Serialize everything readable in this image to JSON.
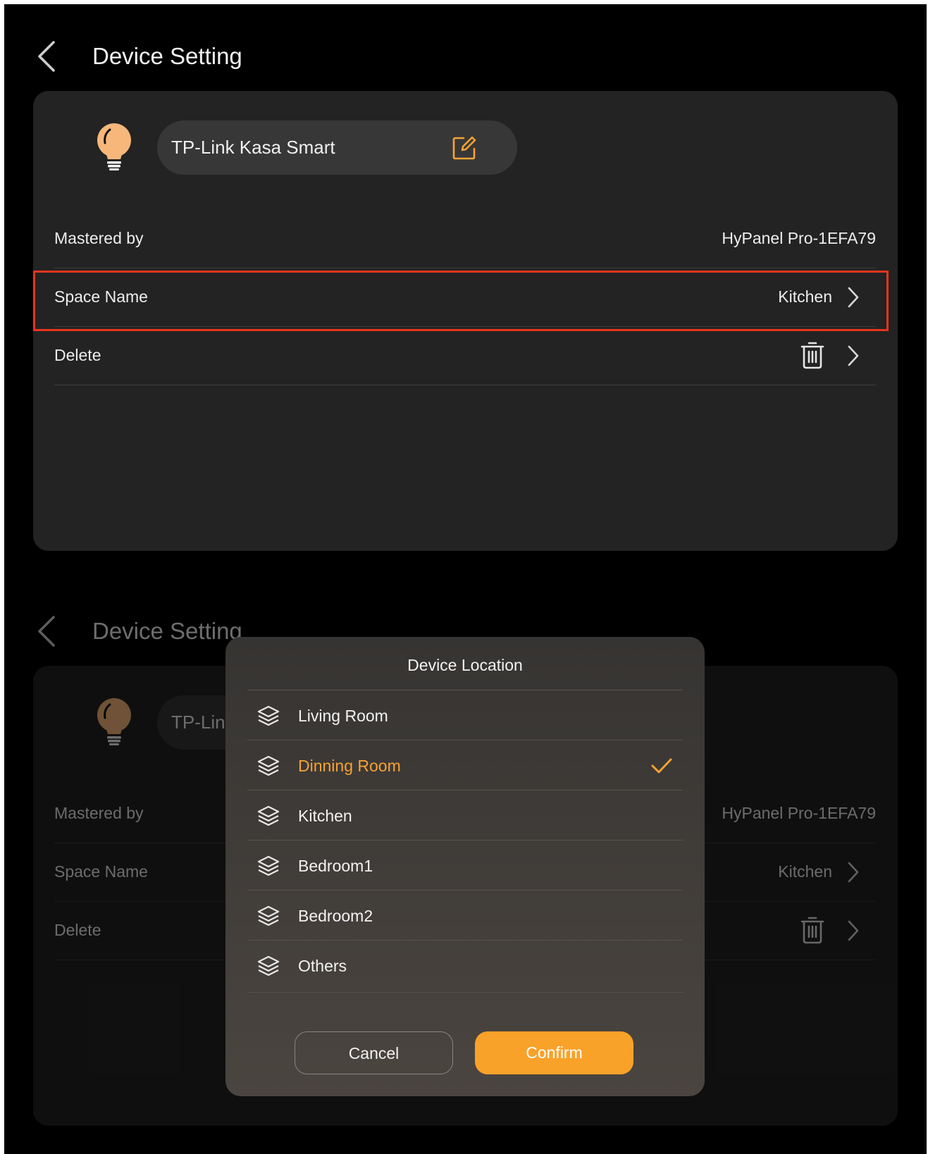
{
  "header": {
    "title": "Device Setting"
  },
  "device": {
    "name": "TP-Link Kasa Smart",
    "bulb_color": "#f7b77a"
  },
  "rows": {
    "mastered_by": {
      "label": "Mastered by",
      "value": "HyPanel Pro-1EFA79"
    },
    "space_name": {
      "label": "Space Name",
      "value": "Kitchen"
    },
    "delete": {
      "label": "Delete"
    }
  },
  "dialog": {
    "title": "Device Location",
    "options": [
      {
        "label": "Living Room",
        "icon": "layers-icon",
        "selected": false
      },
      {
        "label": "Dinning Room",
        "icon": "layers-icon",
        "selected": true
      },
      {
        "label": "Kitchen",
        "icon": "layers-icon",
        "selected": false
      },
      {
        "label": "Bedroom1",
        "icon": "layers-icon",
        "selected": false
      },
      {
        "label": "Bedroom2",
        "icon": "layers-icon",
        "selected": false
      },
      {
        "label": "Others",
        "icon": "layers-icon",
        "selected": false
      }
    ],
    "cancel_label": "Cancel",
    "confirm_label": "Confirm"
  },
  "colors": {
    "accent": "#f9a22a",
    "highlight_box": "#e8341c",
    "background": "#000000",
    "card": "#232323"
  }
}
